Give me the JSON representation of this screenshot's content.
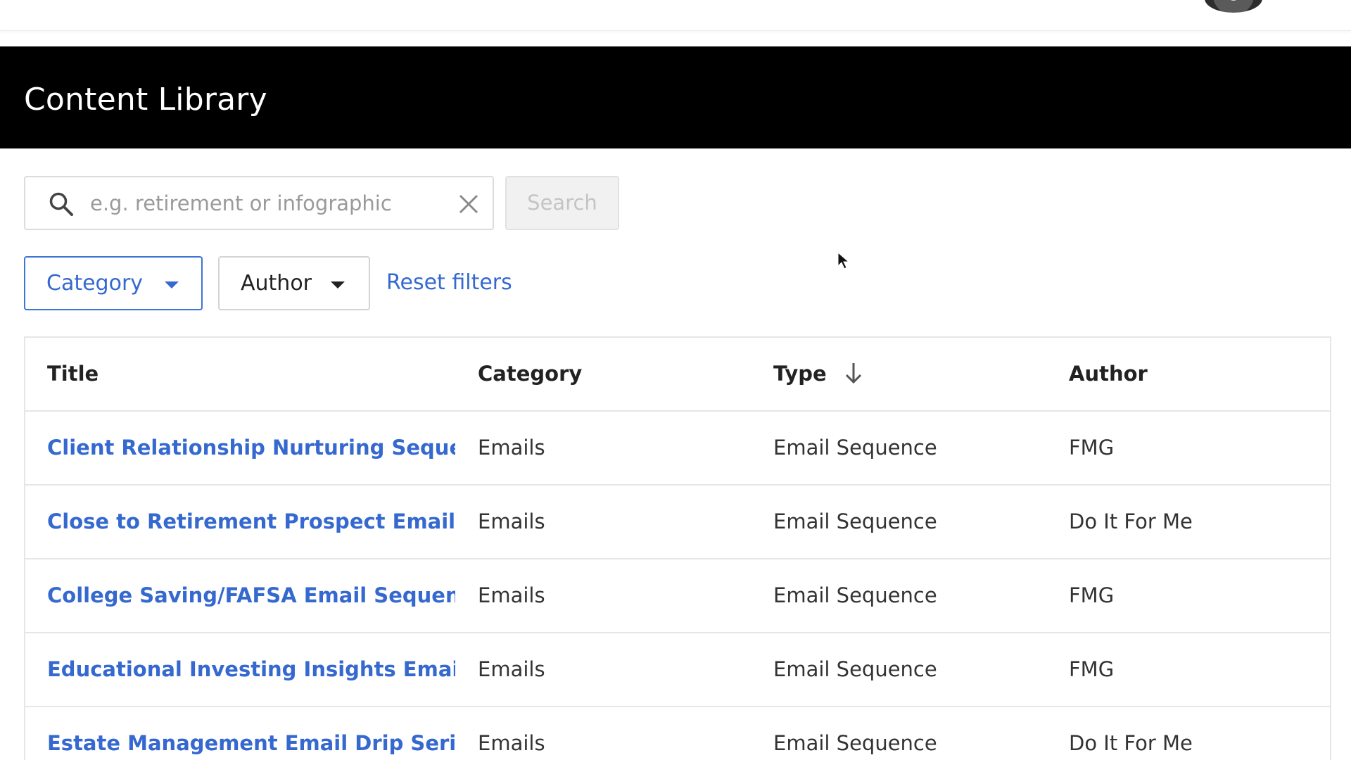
{
  "header": {
    "title": "Content Library"
  },
  "search": {
    "placeholder": "e.g. retirement or infographic",
    "value": "",
    "button_label": "Search",
    "search_icon": "search-icon",
    "clear_icon": "close-icon"
  },
  "filters": {
    "category_label": "Category",
    "author_label": "Author",
    "reset_label": "Reset filters",
    "dropdown_icon": "caret-down-icon"
  },
  "table": {
    "columns": {
      "title": "Title",
      "category": "Category",
      "type": "Type",
      "author": "Author"
    },
    "sort_icon": "arrow-down-icon",
    "rows": [
      {
        "title": "Client Relationship Nurturing Sequence",
        "category": "Emails",
        "type": "Email Sequence",
        "author": "FMG"
      },
      {
        "title": "Close to Retirement Prospect Email Se...",
        "category": "Emails",
        "type": "Email Sequence",
        "author": "Do It For Me"
      },
      {
        "title": "College Saving/FAFSA Email Sequence",
        "category": "Emails",
        "type": "Email Sequence",
        "author": "FMG"
      },
      {
        "title": "Educational Investing Insights Email S...",
        "category": "Emails",
        "type": "Email Sequence",
        "author": "FMG"
      },
      {
        "title": "Estate Management Email Drip Series",
        "category": "Emails",
        "type": "Email Sequence",
        "author": "Do It For Me"
      }
    ]
  },
  "colors": {
    "accent": "#3569cf",
    "header_bg": "#000000"
  }
}
